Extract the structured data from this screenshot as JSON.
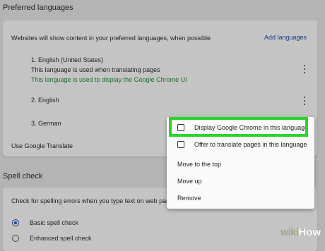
{
  "preferred": {
    "title": "Preferred languages",
    "description": "Websites will show content in your preferred languages, when possible",
    "add_label": "Add languages",
    "languages": [
      {
        "name": "1. English (United States)",
        "note": "This language is used when translating pages",
        "note2": "This language is used to display the Google Chrome UI"
      },
      {
        "name": "2. English"
      },
      {
        "name": "3. German"
      }
    ],
    "translate_label": "Use Google Translate"
  },
  "menu": {
    "items": [
      {
        "label": "Display Google Chrome in this language",
        "checkbox": true,
        "checked": false
      },
      {
        "label": "Offer to translate pages in this language",
        "checkbox": true,
        "checked": false
      },
      {
        "label": "Move to the top"
      },
      {
        "label": "Move up"
      },
      {
        "label": "Remove"
      }
    ]
  },
  "spell": {
    "title": "Spell check",
    "description": "Check for spelling errors when you type text on web page",
    "options": [
      {
        "label": "Basic spell check",
        "selected": true
      },
      {
        "label": "Enhanced spell check",
        "selected": false
      }
    ]
  },
  "watermark": {
    "part1": "wiki",
    "part2": "How"
  },
  "colors": {
    "highlight": "#29d629",
    "link": "#1a3c8c",
    "ui_note": "#1f6b2c"
  }
}
